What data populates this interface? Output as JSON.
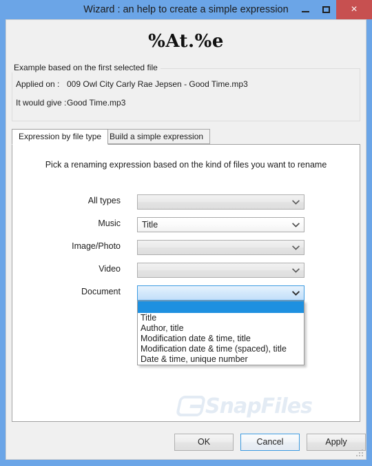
{
  "window": {
    "title": "Wizard : an help to create a simple expression",
    "minimize_label": "Minimize",
    "maximize_label": "Maximize",
    "close_label": "×",
    "titlebar_color": "#6ba5e7",
    "close_color": "#c75050"
  },
  "headline": "%At.%e",
  "example": {
    "legend": "Example based on the first selected file",
    "applied_label": "Applied on :",
    "applied_value": "009 Owl City  Carly Rae Jepsen - Good Time.mp3",
    "result_label": "It would give :",
    "result_value": "Good Time.mp3"
  },
  "tabs": [
    {
      "label": "Expression by file type",
      "active": true
    },
    {
      "label": "Build a simple expression",
      "active": false
    }
  ],
  "panel": {
    "hint": "Pick a renaming expression based on the kind of files you want to rename",
    "rows": [
      {
        "label": "All types",
        "value": "",
        "state": "disabled"
      },
      {
        "label": "Music",
        "value": "Title",
        "state": "enabled"
      },
      {
        "label": "Image/Photo",
        "value": "",
        "state": "disabled"
      },
      {
        "label": "Video",
        "value": "",
        "state": "disabled"
      },
      {
        "label": "Document",
        "value": "",
        "state": "open"
      }
    ],
    "dropdown": {
      "selected_index": 0,
      "options": [
        "",
        "Title",
        "Author, title",
        "Modification date & time, title",
        "Modification date & time (spaced), title",
        "Date & time, unique number"
      ],
      "highlight_color": "#1e90e0"
    }
  },
  "watermark": {
    "text": "SnapFiles",
    "color": "#e3ebf4"
  },
  "footer": {
    "ok_label": "OK",
    "cancel_label": "Cancel",
    "apply_label": "Apply"
  }
}
